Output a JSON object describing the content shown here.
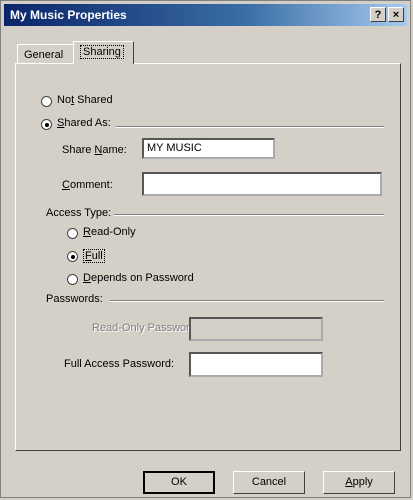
{
  "window": {
    "title": "My Music Properties",
    "help_glyph": "?",
    "close_glyph": "×"
  },
  "tabs": [
    {
      "label": "General",
      "active": false
    },
    {
      "label": "Sharing",
      "active": true
    }
  ],
  "sharing": {
    "not_shared": {
      "label_pre": "No",
      "label_u": "t",
      "label_post": " Shared",
      "checked": false
    },
    "shared_as": {
      "label_pre": "",
      "label_u": "S",
      "label_post": "hared As:",
      "checked": true
    },
    "share_name": {
      "label_pre": "Share ",
      "label_u": "N",
      "label_post": "ame:",
      "value": "MY MUSIC"
    },
    "comment": {
      "label_pre": "",
      "label_u": "C",
      "label_post": "omment:",
      "value": ""
    },
    "access_type": {
      "heading": "Access Type:",
      "read_only": {
        "label_pre": "",
        "label_u": "R",
        "label_post": "ead-Only",
        "checked": false
      },
      "full": {
        "label_pre": "",
        "label_u": "F",
        "label_post": "ull",
        "checked": true
      },
      "depends": {
        "label_pre": "",
        "label_u": "D",
        "label_post": "epends on Password",
        "checked": false
      }
    },
    "passwords": {
      "heading": "Passwords:",
      "read_only_password": {
        "label": "Read-Only Password:",
        "value": "",
        "disabled": true
      },
      "full_access_password": {
        "label": "Full Access Password:",
        "value": ""
      }
    }
  },
  "buttons": {
    "ok": "OK",
    "cancel": "Cancel",
    "apply_u": "A",
    "apply_post": "pply"
  }
}
